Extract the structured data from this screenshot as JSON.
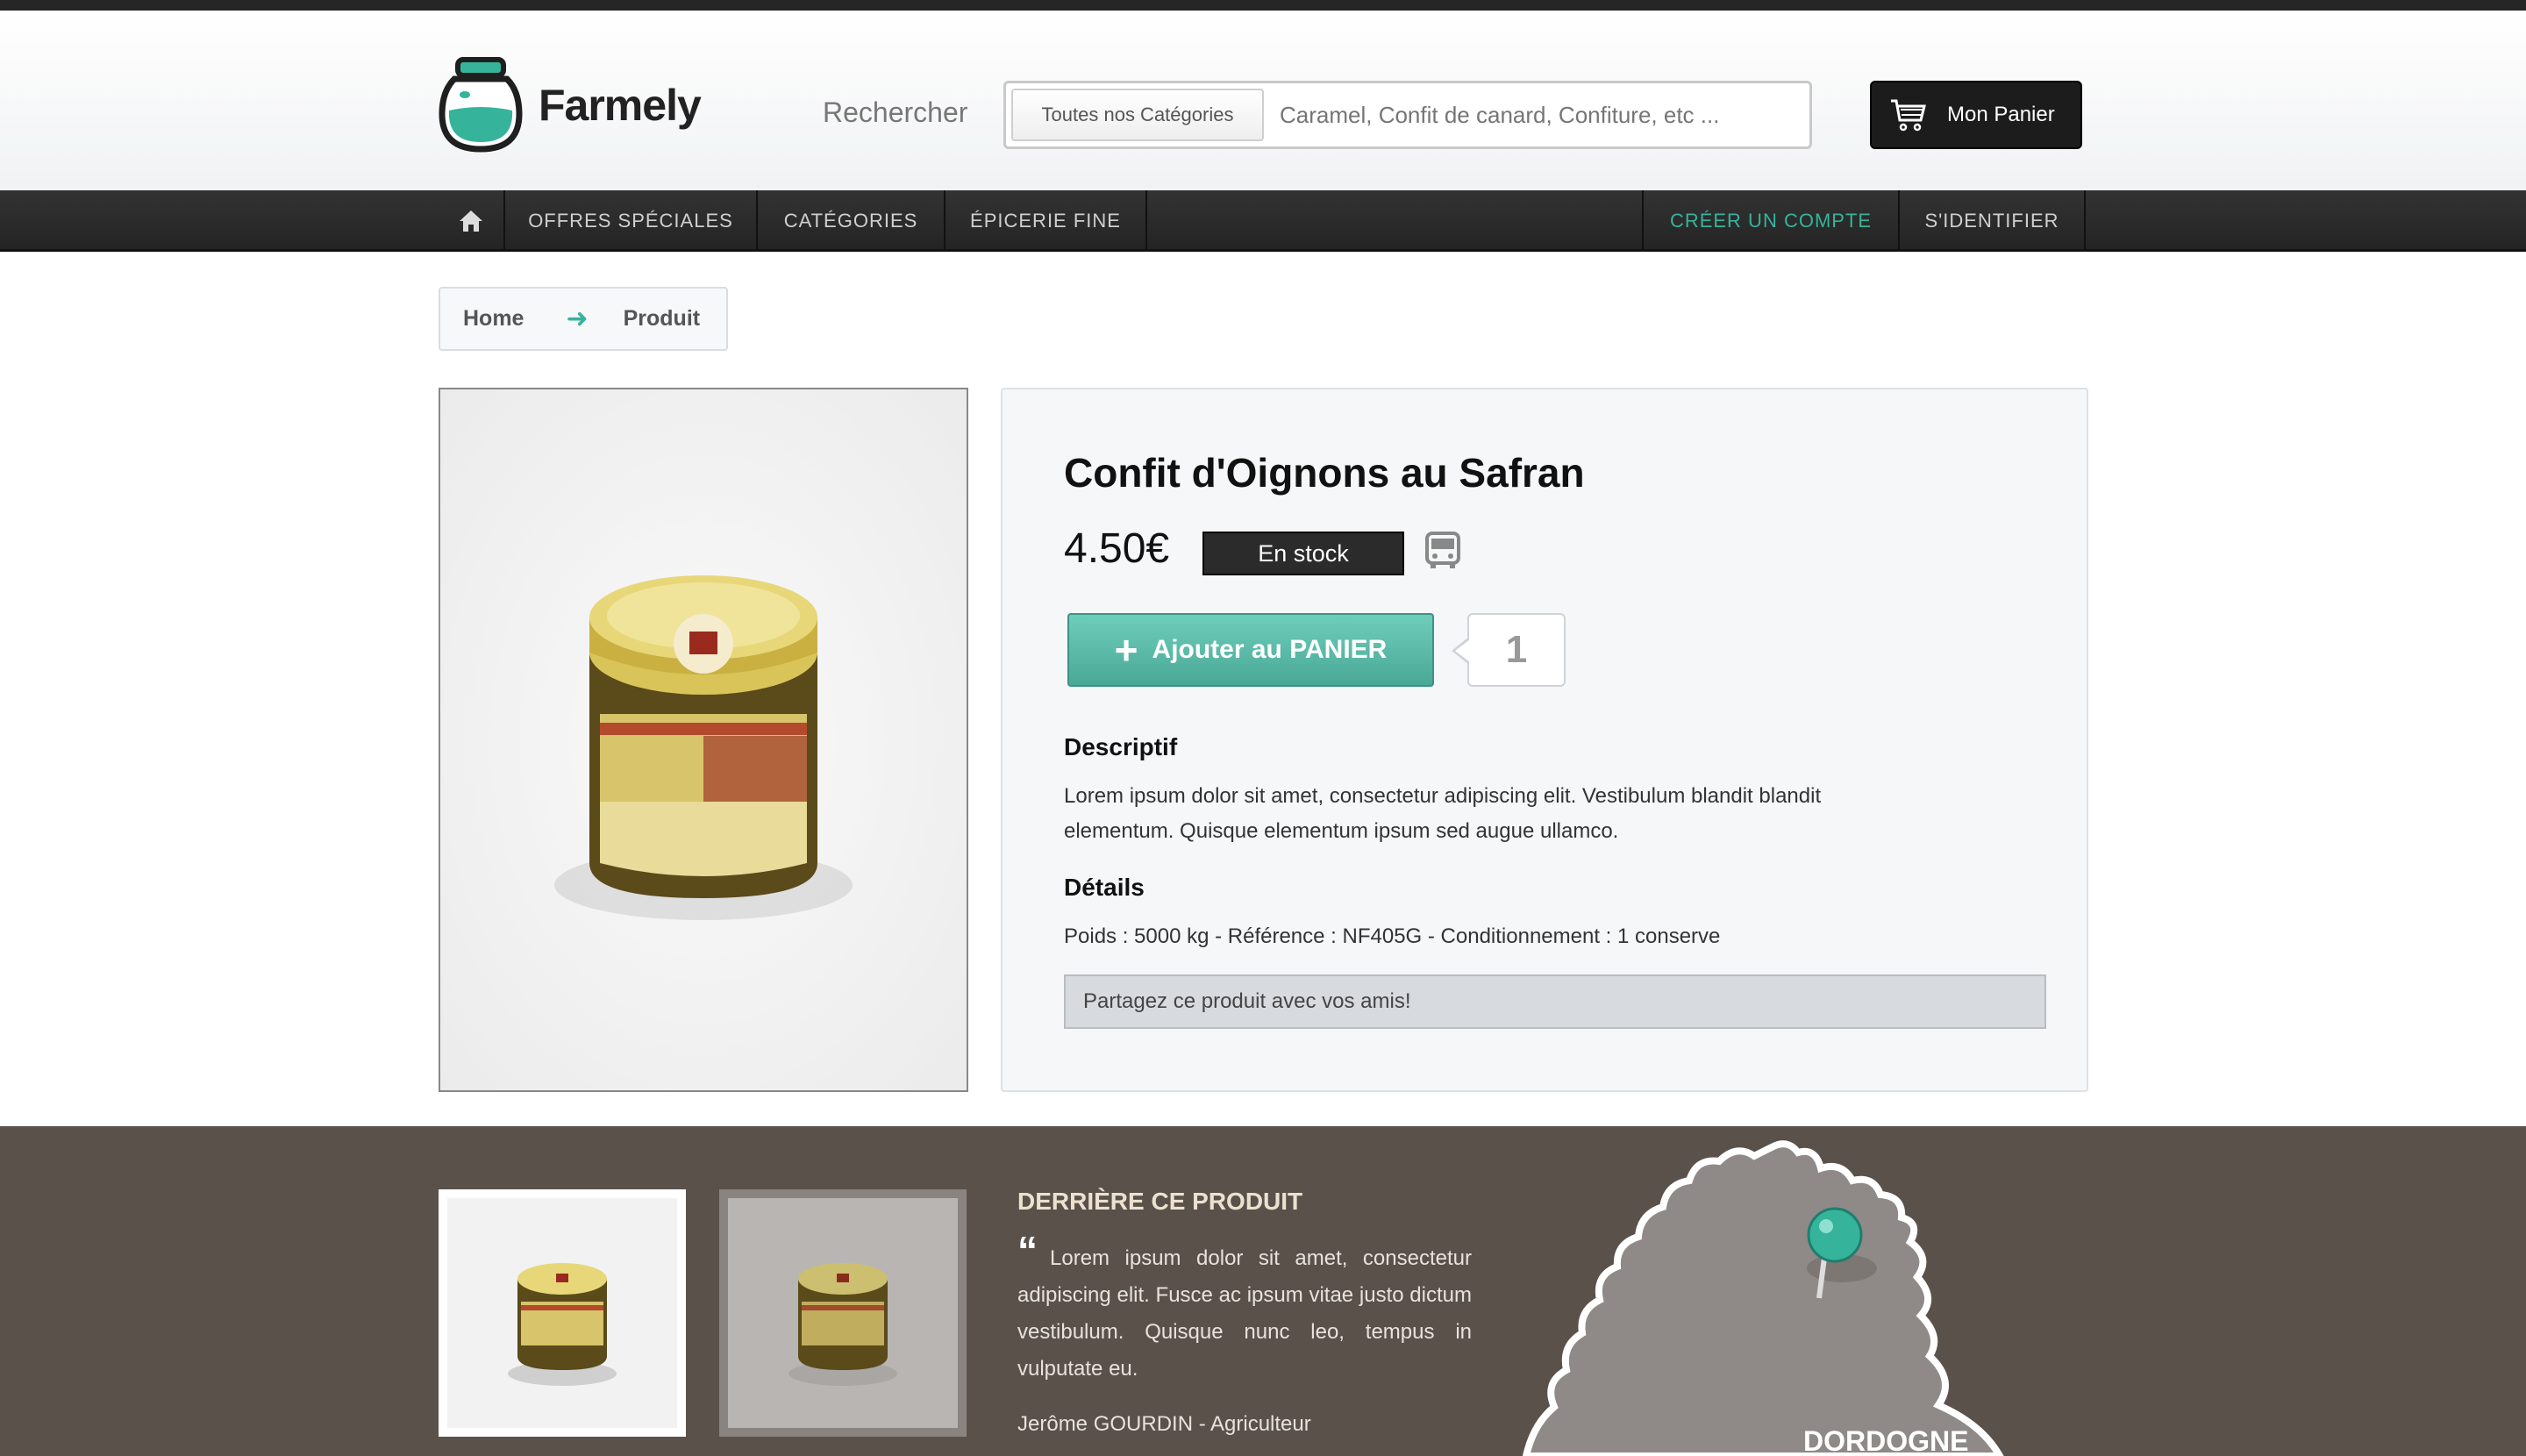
{
  "brand": {
    "name": "Farmely",
    "accent": "#35b49b"
  },
  "search": {
    "label": "Rechercher",
    "category_button": "Toutes nos Catégories",
    "placeholder": "Caramel, Confit de canard, Confiture, etc ..."
  },
  "cart": {
    "label": "Mon Panier",
    "icon": "shopping-cart-icon"
  },
  "nav": {
    "home_icon": "home-icon",
    "items": [
      "OFFRES SPÉCIALES",
      "CATÉGORIES",
      "ÉPICERIE FINE"
    ],
    "right": [
      "CRÉER UN COMPTE",
      "S'IDENTIFIER"
    ]
  },
  "breadcrumb": {
    "home": "Home",
    "separator": "➜",
    "current": "Produit"
  },
  "product": {
    "title": "Confit d'Oignons au Safran",
    "price": "4.50€",
    "stock": "En stock",
    "add_label": "Ajouter au PANIER",
    "add_icon": "+",
    "quantity": "1",
    "desc_title": "Descriptif",
    "desc_line1": "Lorem ipsum dolor sit amet, consectetur adipiscing elit. Vestibulum blandit blandit",
    "desc_line2": "elementum. Quisque elementum ipsum sed augue ullamco.",
    "details_title": "Détails",
    "details": "Poids : 5000 kg - Référence : NF405G - Conditionnement : 1 conserve",
    "share": "Partagez ce produit avec vos amis!"
  },
  "footer": {
    "title": "DERRIÈRE CE PRODUIT",
    "quote_mark": "“",
    "quote": "Lorem ipsum dolor sit amet, consectetur adipiscing elit. Fusce ac ipsum vitae justo dictum vestibulum. Quisque nunc leo, tempus in vulputate eu.",
    "author": "Jerôme GOURDIN - Agriculteur",
    "region": "DORDOGNE"
  }
}
